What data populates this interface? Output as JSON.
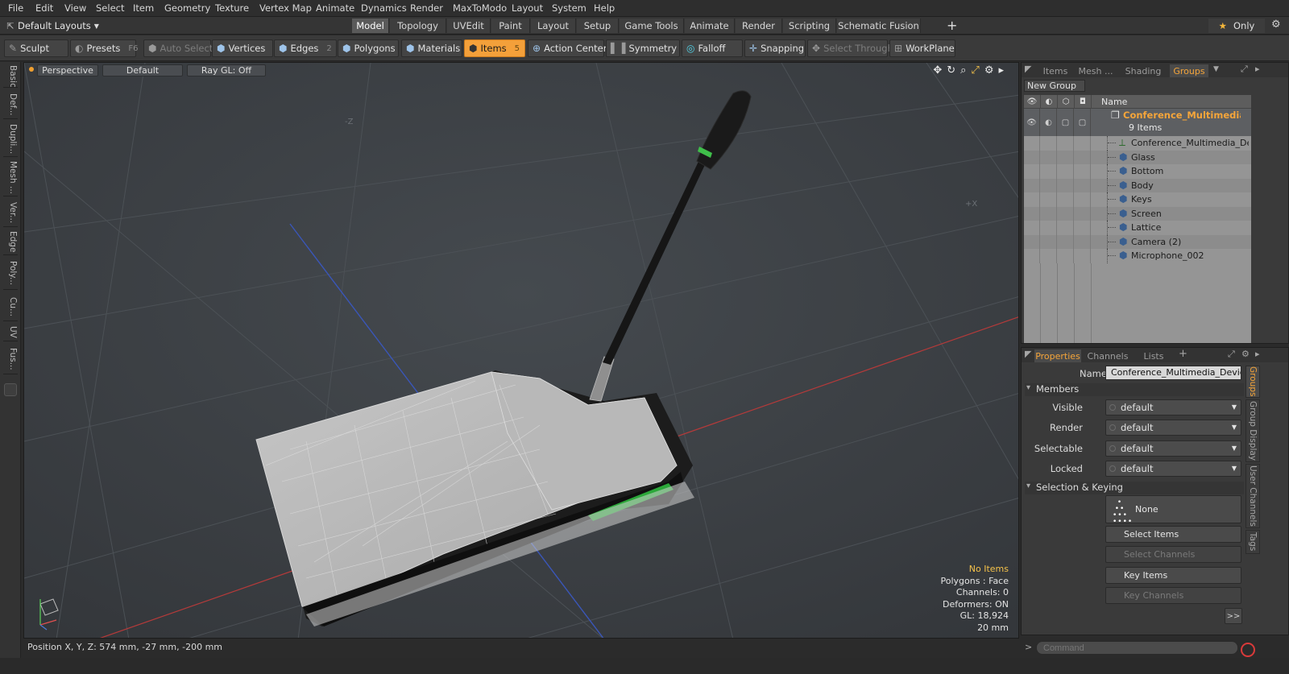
{
  "menubar": [
    "File",
    "Edit",
    "View",
    "Select",
    "Item",
    "Geometry",
    "Texture",
    "Vertex Map",
    "Animate",
    "Dynamics",
    "Render",
    "MaxToModo",
    "Layout",
    "System",
    "Help"
  ],
  "layouts": {
    "label": "Default Layouts"
  },
  "layout_tabs": [
    "Model",
    "Topology",
    "UVEdit",
    "Paint",
    "Layout",
    "Setup",
    "Game Tools",
    "Animate",
    "Render",
    "Scripting",
    "Schematic Fusion"
  ],
  "active_layout_tab": "Model",
  "only_label": "Only",
  "toolbar": {
    "sculpt": "Sculpt",
    "presets": "Presets",
    "presets_key": "F6",
    "auto_select": "Auto Select",
    "vertices": "Vertices",
    "vertices_key": "1",
    "edges": "Edges",
    "edges_key": "2",
    "polygons": "Polygons",
    "materials": "Materials",
    "items": "Items",
    "items_key": "5",
    "action_center": "Action Center",
    "symmetry": "Symmetry",
    "falloff": "Falloff",
    "snapping": "Snapping",
    "select_through": "Select Through",
    "workplane": "WorkPlane"
  },
  "left_tabs": [
    "Basic",
    "Def...",
    "Dupli...",
    "Mesh ...",
    "Ver...",
    "Edge",
    "Poly...",
    "Cu...",
    "UV",
    "Fus..."
  ],
  "viewport": {
    "projection": "Perspective",
    "shading": "Default",
    "raygl": "Ray GL: Off",
    "axis_neg_z": "-Z",
    "axis_pos_x": "+X",
    "info": {
      "selection": "No Items",
      "polygons": "Polygons : Face",
      "channels": "Channels: 0",
      "deformers": "Deformers: ON",
      "gl": "GL: 18,924",
      "scale": "20 mm"
    }
  },
  "status": {
    "position": "Position X, Y, Z:  574 mm, -27 mm, -200 mm"
  },
  "groups_panel": {
    "tabs": [
      "Items",
      "Mesh ...",
      "Shading",
      "Groups"
    ],
    "active_tab": "Groups",
    "new_group": "New Group",
    "name_header": "Name",
    "root": {
      "name": "Conference_Multimedia_ ...",
      "count": "9 Items"
    },
    "items": [
      "Conference_Multimedia_De ...",
      "Glass",
      "Bottom",
      "Body",
      "Keys",
      "Screen",
      "Lattice",
      "Camera (2)",
      "Microphone_002"
    ]
  },
  "properties_panel": {
    "tabs": [
      "Properties",
      "Channels",
      "Lists"
    ],
    "active_tab": "Properties",
    "name_label": "Name",
    "name_value": "Conference_Multimedia_Device_v",
    "members_section": "Members",
    "visible_label": "Visible",
    "visible_value": "default",
    "render_label": "Render",
    "render_value": "default",
    "selectable_label": "Selectable",
    "selectable_value": "default",
    "locked_label": "Locked",
    "locked_value": "default",
    "selection_section": "Selection & Keying",
    "none_label": "None",
    "select_items": "Select Items",
    "select_channels": "Select Channels",
    "key_items": "Key Items",
    "key_channels": "Key Channels",
    "more": ">>",
    "side_tabs": [
      "Groups",
      "Group Display",
      "User Channels",
      "Tags"
    ]
  },
  "command": {
    "placeholder": "Command"
  }
}
